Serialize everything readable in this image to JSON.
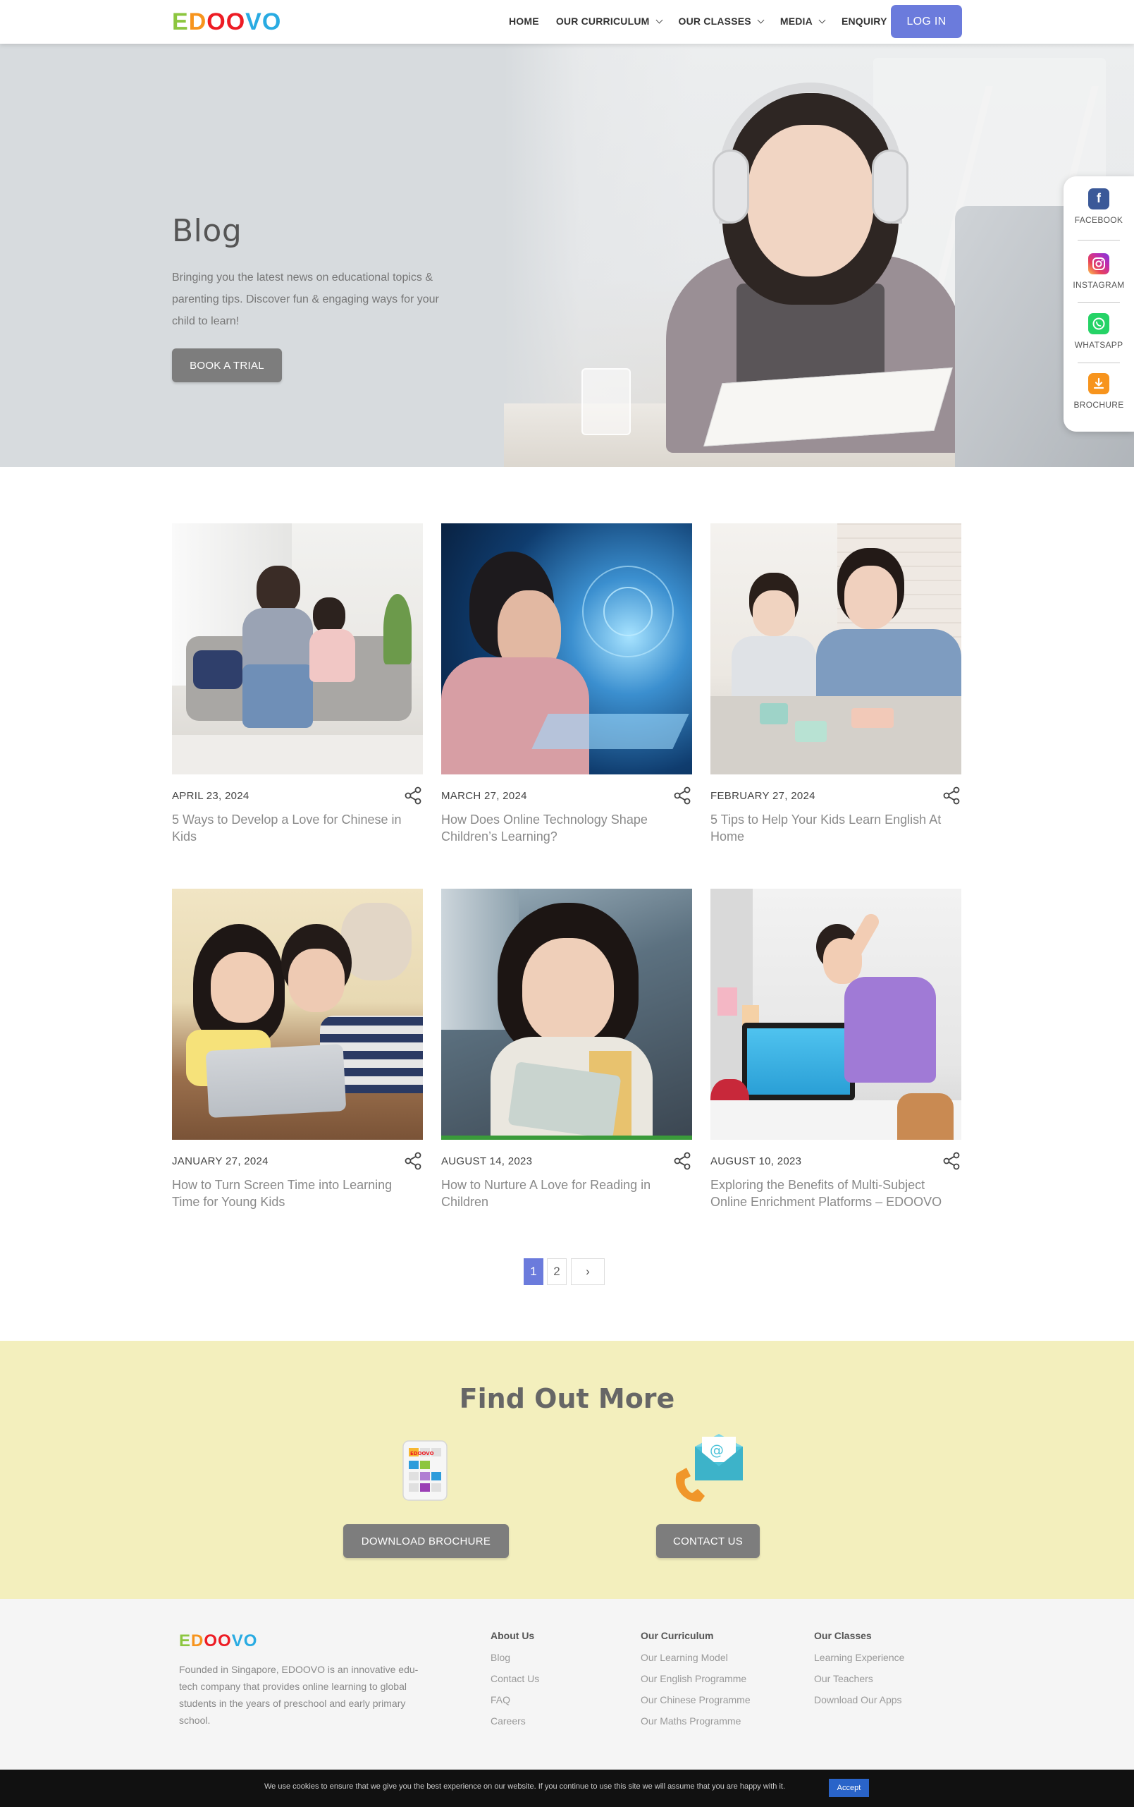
{
  "brand": {
    "logo_letters": [
      "E",
      "D",
      "O",
      "O",
      "V",
      "O"
    ],
    "logo_colors": [
      "#8cc63f",
      "#f7941d",
      "#ed1c24",
      "#ed1c24",
      "#29abe2",
      "#29abe2"
    ]
  },
  "nav": {
    "items": [
      {
        "label": "HOME",
        "dropdown": false
      },
      {
        "label": "OUR CURRICULUM",
        "dropdown": true
      },
      {
        "label": "OUR CLASSES",
        "dropdown": true
      },
      {
        "label": "MEDIA",
        "dropdown": true
      },
      {
        "label": "ENQUIRY",
        "dropdown": true
      }
    ],
    "login_label": "LOG IN"
  },
  "hero": {
    "title": "Blog",
    "description": "Bringing you the latest news on educational topics & parenting tips. Discover fun & engaging ways for your child to learn!",
    "cta_label": "BOOK A TRIAL"
  },
  "social": [
    {
      "label": "FACEBOOK",
      "icon": "facebook-icon",
      "color": "#3b5998"
    },
    {
      "label": "INSTAGRAM",
      "icon": "instagram-icon",
      "color": "#d6249f"
    },
    {
      "label": "WHATSAPP",
      "icon": "whatsapp-icon",
      "color": "#25d366"
    },
    {
      "label": "BROCHURE",
      "icon": "download-icon",
      "color": "#f7941d"
    }
  ],
  "posts": [
    {
      "date": "APRIL 23, 2024",
      "title": "5 Ways to Develop a Love for Chinese in Kids"
    },
    {
      "date": "MARCH 27, 2024",
      "title": "How Does Online Technology Shape Children’s Learning?"
    },
    {
      "date": "FEBRUARY 27, 2024",
      "title": "5 Tips to Help Your Kids Learn English At Home"
    },
    {
      "date": "JANUARY 27, 2024",
      "title": "How to Turn Screen Time into Learning Time for Young Kids"
    },
    {
      "date": "AUGUST 14, 2023",
      "title": "How to Nurture A Love for Reading in Children"
    },
    {
      "date": "AUGUST 10, 2023",
      "title": "Exploring the Benefits of Multi-Subject Online Enrichment Platforms – EDOOVO"
    }
  ],
  "pagination": {
    "current": "1",
    "pages": [
      "2"
    ],
    "next_symbol": "›"
  },
  "find_out_more": {
    "title": "Find Out More",
    "brochure_label": "DOWNLOAD BROCHURE",
    "contact_label": "CONTACT US"
  },
  "footer": {
    "description": "Founded in Singapore, EDOOVO is an innovative edu-tech company that provides online learning to global students in the years of preschool and early primary school.",
    "columns": [
      {
        "heading": "About Us",
        "links": [
          "Blog",
          "Contact Us",
          "FAQ",
          "Careers"
        ]
      },
      {
        "heading": "Our Curriculum",
        "links": [
          "Our Learning Model",
          "Our English Programme",
          "Our Chinese Programme",
          "Our Maths Programme"
        ]
      },
      {
        "heading": "Our Classes",
        "links": [
          "Learning Experience",
          "Our Teachers",
          "Download Our Apps"
        ]
      }
    ]
  },
  "cookie": {
    "text": "We use cookies to ensure that we give you the best experience on our website. If you continue to use this site we will assume that you are happy with it.",
    "accept_label": "Accept"
  },
  "colors": {
    "accent": "#6b7bdc",
    "button_gray": "#7d7d7d",
    "find_out_more_bg": "#f3efbd",
    "hero_bg": "#d7dbde"
  }
}
